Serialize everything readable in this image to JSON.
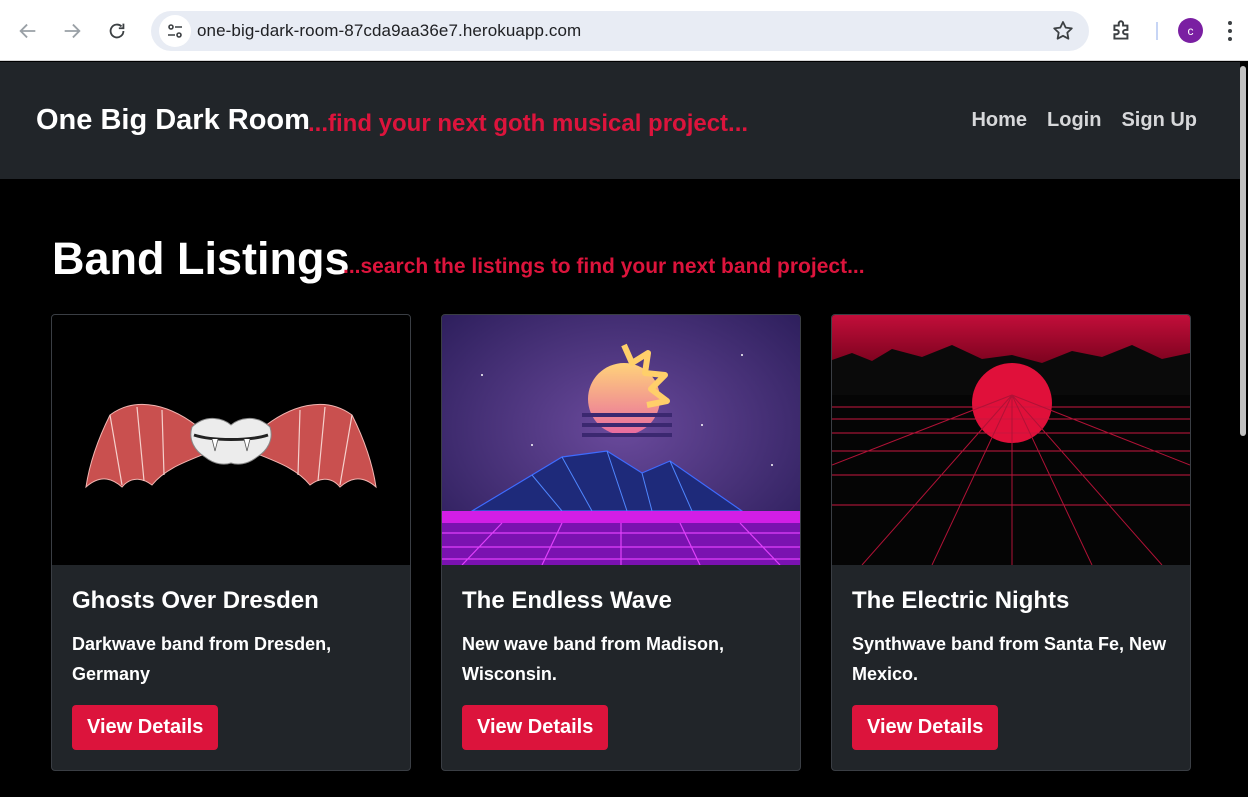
{
  "browser": {
    "url": "one-big-dark-room-87cda9aa36e7.herokuapp.com",
    "profile_initial": "c",
    "profile_color": "#7a1fa2"
  },
  "header": {
    "brand": "One Big Dark Room",
    "tagline": "...find your next goth musical project...",
    "nav": [
      "Home",
      "Login",
      "Sign Up"
    ]
  },
  "main": {
    "title": "Band Listings",
    "subtitle": "...search the listings to find your next band project..."
  },
  "cards": [
    {
      "title": "Ghosts Over Dresden",
      "description": "Darkwave band from Dresden, Germany",
      "button": "View Details",
      "image_icon": "bat-lips-image"
    },
    {
      "title": "The Endless Wave",
      "description": "New wave band from Madison, Wisconsin.",
      "button": "View Details",
      "image_icon": "retro-sun-mountains-image"
    },
    {
      "title": "The Electric Nights",
      "description": "Synthwave band from Santa Fe, New Mexico.",
      "button": "View Details",
      "image_icon": "red-sun-grid-image"
    }
  ],
  "colors": {
    "accent": "#dc143c",
    "header_bg": "#212529",
    "page_bg": "#000000"
  }
}
